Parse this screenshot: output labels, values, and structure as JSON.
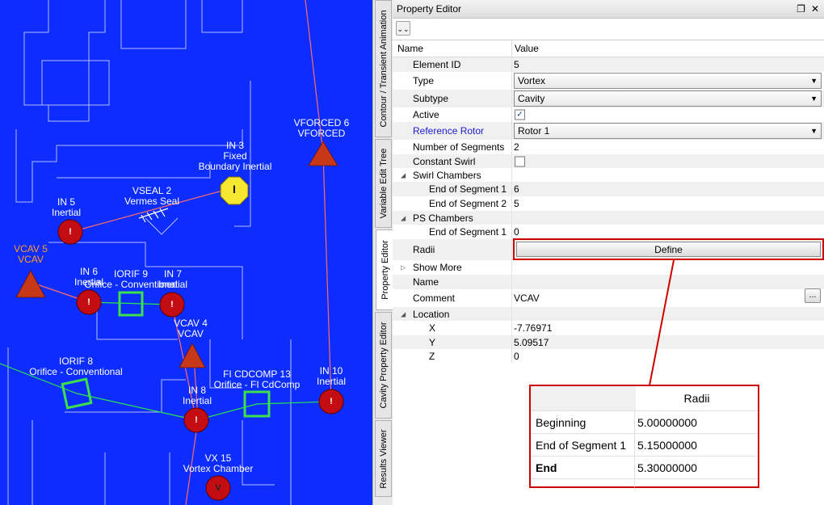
{
  "canvas": {
    "nodes": [
      {
        "id": "vforced6",
        "lines": [
          "VFORCED  6",
          "VFORCED"
        ]
      },
      {
        "id": "in3",
        "lines": [
          "IN 3",
          "Fixed",
          "Boundary Inertial"
        ]
      },
      {
        "id": "vseal2",
        "lines": [
          "VSEAL  2",
          "Vermes Seal"
        ]
      },
      {
        "id": "in5",
        "lines": [
          "IN 5",
          "Inertial"
        ]
      },
      {
        "id": "vcav5",
        "lines": [
          "VCAV  5",
          "VCAV"
        ]
      },
      {
        "id": "in6",
        "lines": [
          "IN 6",
          "Inertial"
        ]
      },
      {
        "id": "iorif9",
        "lines": [
          "IORIF  9",
          "Orifice - Conventional"
        ]
      },
      {
        "id": "in7",
        "lines": [
          "IN 7",
          "Inertial"
        ]
      },
      {
        "id": "vcav4",
        "lines": [
          "VCAV  4",
          "VCAV"
        ]
      },
      {
        "id": "iorif8",
        "lines": [
          "IORIF  8",
          "Orifice - Conventional"
        ]
      },
      {
        "id": "ficdcomp13",
        "lines": [
          "FI CDCOMP 13",
          "Orifice - FI CdComp"
        ]
      },
      {
        "id": "in10",
        "lines": [
          "IN 10",
          "Inertial"
        ]
      },
      {
        "id": "in8",
        "lines": [
          "IN 8",
          "Inertial"
        ]
      },
      {
        "id": "vx15",
        "lines": [
          "VX 15",
          "Vortex Chamber"
        ]
      }
    ],
    "glyphs": {
      "inertial": "!",
      "fixed": "I",
      "vortex": "V"
    }
  },
  "side_tabs": [
    "Contour / Transient Animation",
    "Variable Edit Tree",
    "Property Editor",
    "Cavity Property Editor",
    "Results Viewer"
  ],
  "panel": {
    "title": "Property Editor",
    "collapse_icon": "double-chevron-down-icon",
    "col_name": "Name",
    "col_value": "Value",
    "rows": [
      {
        "name": "Element ID",
        "value": "5"
      },
      {
        "name": "Type",
        "value": "Vortex"
      },
      {
        "name": "Subtype",
        "value": "Cavity"
      },
      {
        "name": "Active",
        "value": "✓"
      },
      {
        "name": "Reference Rotor",
        "value": "Rotor 1"
      },
      {
        "name": "Number of Segments",
        "value": "2"
      },
      {
        "name": "Constant Swirl",
        "value": ""
      },
      {
        "name": "Swirl Chambers",
        "value": ""
      },
      {
        "name": "End of Segment 1",
        "value": "6"
      },
      {
        "name": "End of Segment 2",
        "value": "5"
      },
      {
        "name": "PS Chambers",
        "value": ""
      },
      {
        "name": "End of Segment 1",
        "value": "0"
      },
      {
        "name": "Radii",
        "value": "Define"
      },
      {
        "name": "Show More",
        "value": ""
      },
      {
        "name": "Name",
        "value": ""
      },
      {
        "name": "Comment",
        "value": "VCAV"
      },
      {
        "name": "Location",
        "value": ""
      },
      {
        "name": "X",
        "value": "-7.76971"
      },
      {
        "name": "Y",
        "value": "5.09517"
      },
      {
        "name": "Z",
        "value": "0"
      }
    ],
    "comment_button": "...",
    "colors": {
      "link": "#1a1acc",
      "highlight": "#d10000"
    }
  },
  "radii_table": {
    "header": "Radii",
    "rows": [
      {
        "label": "Beginning",
        "value": "5.00000000"
      },
      {
        "label": "End of Segment 1",
        "value": "5.15000000"
      },
      {
        "label": "End",
        "value": "5.30000000"
      }
    ]
  }
}
